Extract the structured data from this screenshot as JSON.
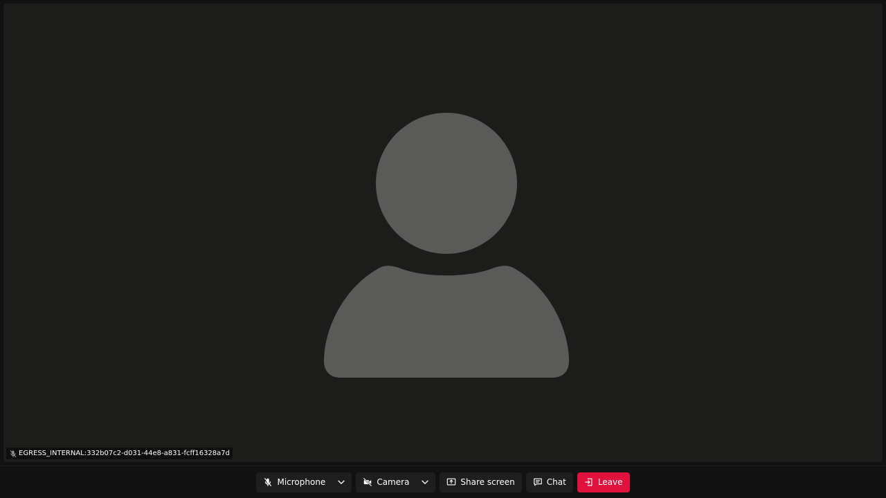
{
  "participant": {
    "identity": "EGRESS_INTERNAL:332b07c2-d031-44e8-a831-fcff16328a7d",
    "mic_icon": "mic-muted-icon",
    "avatar_icon": "person-placeholder-icon"
  },
  "controls": {
    "microphone": {
      "label": "Microphone",
      "icon": "mic-muted-icon"
    },
    "camera": {
      "label": "Camera",
      "icon": "camera-off-icon"
    },
    "share_screen": {
      "label": "Share screen",
      "icon": "share-screen-icon"
    },
    "chat": {
      "label": "Chat",
      "icon": "chat-icon"
    },
    "leave": {
      "label": "Leave",
      "icon": "leave-icon"
    },
    "device_menu_icon": "chevron-down-icon"
  },
  "colors": {
    "stage_background": "#1c1c1b",
    "placeholder": "#5a5a59",
    "leave_button": "#e0123d",
    "button_background": "#1e1e1e"
  }
}
